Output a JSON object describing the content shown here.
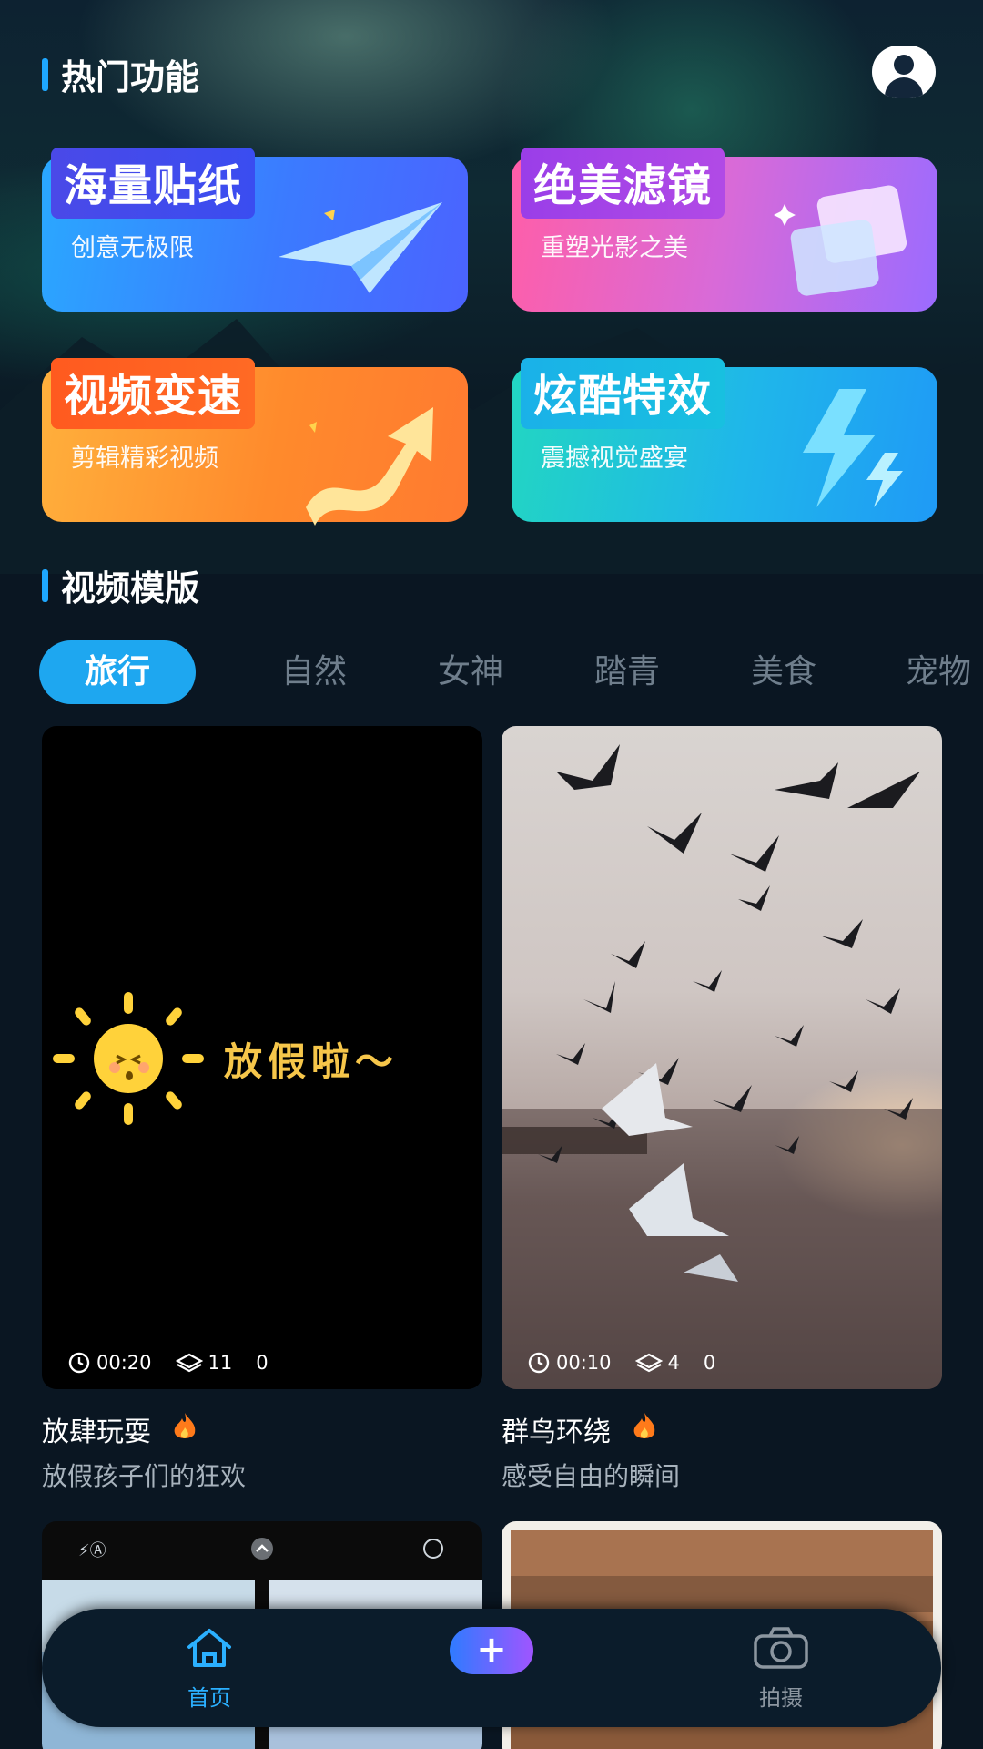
{
  "hot_section": {
    "title": "热门功能"
  },
  "features": [
    {
      "title": "海量贴纸",
      "subtitle": "创意无极限"
    },
    {
      "title": "绝美滤镜",
      "subtitle": "重塑光影之美"
    },
    {
      "title": "视频变速",
      "subtitle": "剪辑精彩视频"
    },
    {
      "title": "炫酷特效",
      "subtitle": "震撼视觉盛宴"
    }
  ],
  "template_section": {
    "title": "视频模版"
  },
  "tabs": [
    {
      "label": "旅行",
      "active": true
    },
    {
      "label": "自然"
    },
    {
      "label": "女神"
    },
    {
      "label": "踏青"
    },
    {
      "label": "美食"
    },
    {
      "label": "宠物"
    }
  ],
  "templates": [
    {
      "name": "放肆玩耍",
      "desc": "放假孩子们的狂欢",
      "duration": "00:20",
      "layers": "11",
      "count": "0",
      "overlay_text": "放假啦～"
    },
    {
      "name": "群鸟环绕",
      "desc": "感受自由的瞬间",
      "duration": "00:10",
      "layers": "4",
      "count": "0"
    }
  ],
  "nav": {
    "home_label": "首页",
    "plus_label": "+",
    "shoot_label": "拍摄"
  },
  "colors": {
    "accent": "#1ea7f0",
    "background": "#0a1622",
    "nav_active": "#2bb0ff"
  },
  "icons": [
    "user-avatar-icon",
    "clock-icon",
    "layers-icon",
    "fire-icon",
    "home-icon",
    "camera-icon",
    "plus-icon"
  ]
}
